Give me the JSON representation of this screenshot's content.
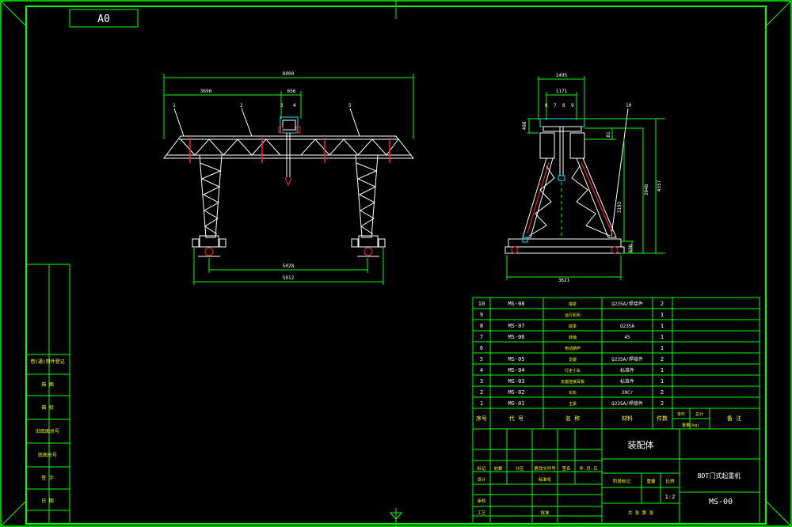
{
  "drawing": {
    "sheet_size": "A0",
    "title": "装配体",
    "product_name": "BDT门式起重机",
    "drawing_number": "MS-00",
    "scale": "1:2"
  },
  "front_view": {
    "dims": {
      "overall_span": "8000",
      "left_offset": "3696",
      "hoist_width": "656",
      "rail_span": "5028",
      "base_span": "5912"
    },
    "balloons": [
      "1",
      "2",
      "3",
      "4",
      "5"
    ]
  },
  "side_view": {
    "dims": {
      "top_width": "1495",
      "inner_width": "1171",
      "base_width": "3621",
      "total_height": "4357",
      "leg_height": "3948",
      "inner_height": "3193",
      "girder_depth": "498",
      "small_gap": "81",
      "base_height": "696"
    },
    "balloons": [
      "6",
      "7",
      "8",
      "9",
      "10"
    ]
  },
  "bom": {
    "headers": [
      "序号",
      "代 号",
      "名 称",
      "材料",
      "件数",
      "单件",
      "总计",
      "重量(kg)",
      "备 注"
    ],
    "rows": [
      {
        "no": "10",
        "code": "MS-08",
        "name": "端梁",
        "material": "Q235A/焊接件",
        "qty": "2"
      },
      {
        "no": "9",
        "code": "",
        "name": "运行机构",
        "material": "",
        "qty": "1"
      },
      {
        "no": "8",
        "code": "MS-07",
        "name": "底梁",
        "material": "Q235A",
        "qty": "1"
      },
      {
        "no": "7",
        "code": "MS-06",
        "name": "转轴",
        "material": "45",
        "qty": "1"
      },
      {
        "no": "6",
        "code": "",
        "name": "电动葫芦",
        "material": "",
        "qty": "1"
      },
      {
        "no": "5",
        "code": "MS-05",
        "name": "支腿",
        "material": "Q235A/焊接件",
        "qty": "2"
      },
      {
        "no": "4",
        "code": "MS-04",
        "name": "行走小车",
        "material": "标准件",
        "qty": "1"
      },
      {
        "no": "3",
        "code": "MS-03",
        "name": "支腿连接耳板",
        "material": "标准件",
        "qty": "1"
      },
      {
        "no": "2",
        "code": "MS-02",
        "name": "车轮",
        "material": "20Cr",
        "qty": "2"
      },
      {
        "no": "1",
        "code": "MS-01",
        "name": "主梁",
        "material": "Q235A/焊接件",
        "qty": "2"
      }
    ]
  },
  "title_block": {
    "labels": [
      "标记",
      "处数",
      "分区",
      "更改文件号",
      "签名",
      "年.月.日",
      "设计",
      "标准化",
      "审核",
      "工艺",
      "批准",
      "阶段标记",
      "重量",
      "比例",
      "共 张 第 张"
    ]
  },
  "side_panel": {
    "labels": [
      "借(通)用件登记",
      "描 图",
      "描 校",
      "旧底图总号",
      "底图总号",
      "签 字",
      "日 期"
    ]
  },
  "colors": {
    "frame": "#00ff00",
    "geometry": "#ffffff",
    "accent": "#ff2020",
    "hoist": "#00e5ff",
    "text": "#ffff00"
  }
}
